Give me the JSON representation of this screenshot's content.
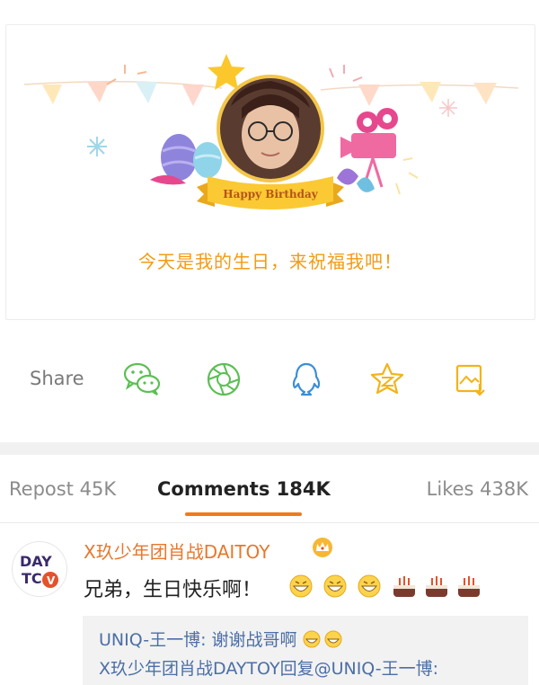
{
  "birthday_card": {
    "badge_text": "Happy Birthday",
    "message": "今天是我的生日，来祝福我吧！"
  },
  "share": {
    "label": "Share",
    "icons": [
      "wechat-icon",
      "moments-icon",
      "qq-icon",
      "qzone-icon",
      "save-image-icon"
    ]
  },
  "tabs": [
    {
      "label": "Repost 45K"
    },
    {
      "label": "Comments 184K",
      "active": true
    },
    {
      "label": "Likes 438K"
    }
  ],
  "comment": {
    "username": "X玖少年团肖战DAITOY",
    "text": "兄弟，生日快乐啊！",
    "emoji_icons": [
      "grin-emoji",
      "grin-emoji",
      "grin-emoji",
      "cake-emoji",
      "cake-emoji",
      "cake-emoji"
    ],
    "replies": [
      {
        "text": "UNIQ-王一博: 谢谢战哥啊"
      },
      {
        "text": "X玖少年团肖战DAYTOY回复@UNIQ-王一博:"
      }
    ]
  },
  "colors": {
    "accent": "#f07a1a",
    "username": "#e6782e",
    "message": "#f39b14",
    "link": "#4c6fa6",
    "share_green": "#5cbf54",
    "share_blue": "#3b8fd8",
    "share_gold": "#f3b31b"
  }
}
